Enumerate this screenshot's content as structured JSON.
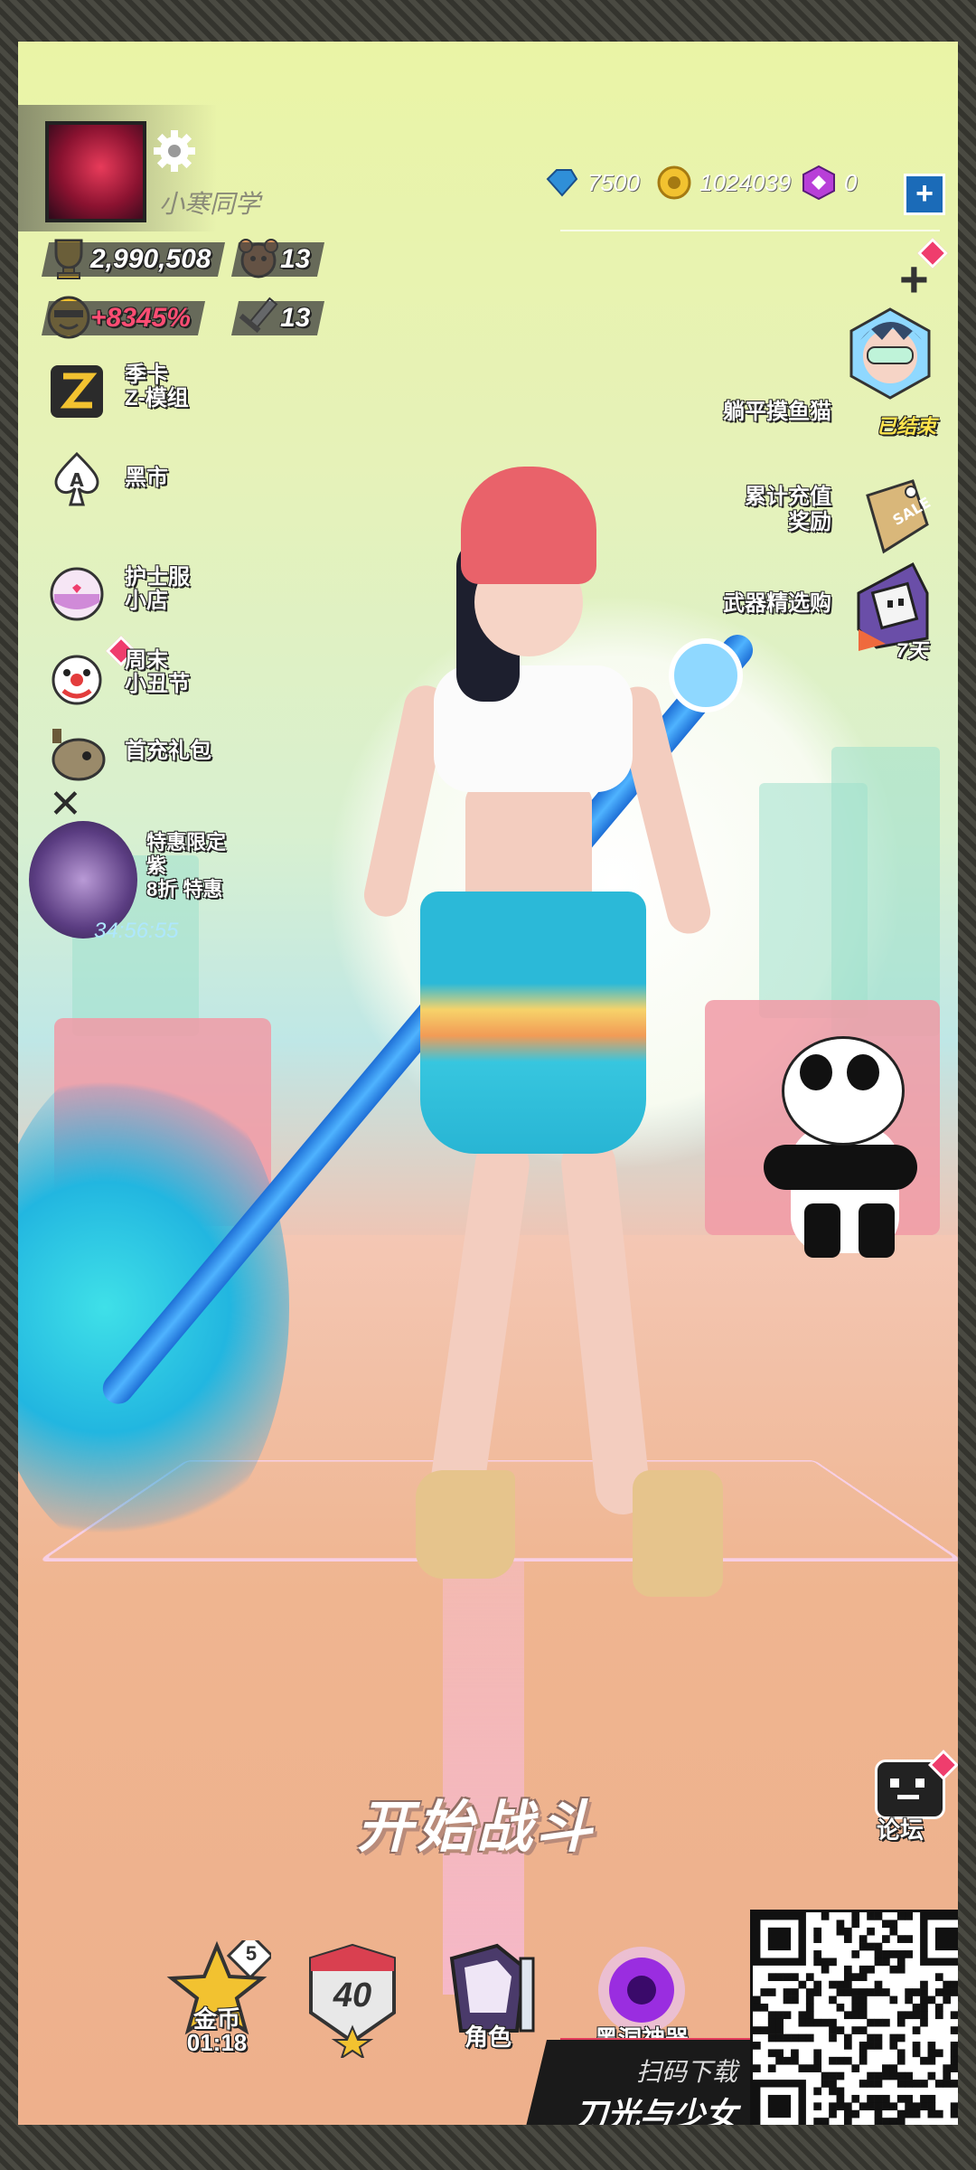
{
  "player": {
    "name": "小寒同学",
    "trophies": "2,990,508",
    "bear_level": "13",
    "bonus": "+8345%",
    "sword_level": "13"
  },
  "currency": {
    "gems": "7500",
    "coins": "1024039",
    "cubes": "0"
  },
  "left_menu": [
    {
      "label_1": "季卡",
      "label_2": "Z-模组",
      "icon": "z-card-icon"
    },
    {
      "label_1": "黑市",
      "label_2": "",
      "icon": "spade-icon"
    },
    {
      "label_1": "护士服",
      "label_2": "小店",
      "icon": "nurse-shop-icon"
    },
    {
      "label_1": "周末",
      "label_2": "小丑节",
      "icon": "clown-icon"
    },
    {
      "label_1": "首充礼包",
      "label_2": "",
      "icon": "gift-pack-icon"
    }
  ],
  "promo": {
    "line_1": "特惠限定",
    "line_2": "紫",
    "line_3": "8折 特惠",
    "timer": "34:56:55"
  },
  "right_menu": [
    {
      "label_1": "躺平摸鱼猫",
      "label_2": "",
      "sub": "已结束"
    },
    {
      "label_1": "累计充值",
      "label_2": "奖励",
      "sub": ""
    },
    {
      "label_1": "武器精选购",
      "label_2": "",
      "sub": "7天"
    }
  ],
  "start_button": "开始战斗",
  "forum": "论坛",
  "bottom_bar": {
    "coins_label": "金币",
    "coins_timer": "01:18",
    "coins_badge": "5",
    "level_badge": "40",
    "role_label": "角色",
    "blackhole_label": "黑洞神器"
  },
  "download": {
    "scan_text": "扫码下载",
    "game_title": "刀光与少女"
  },
  "colors": {
    "accent_red": "#ef3d6d",
    "gem_blue": "#2f8fd8",
    "coin_gold": "#f2c230",
    "cube_purple": "#b83fd8"
  }
}
